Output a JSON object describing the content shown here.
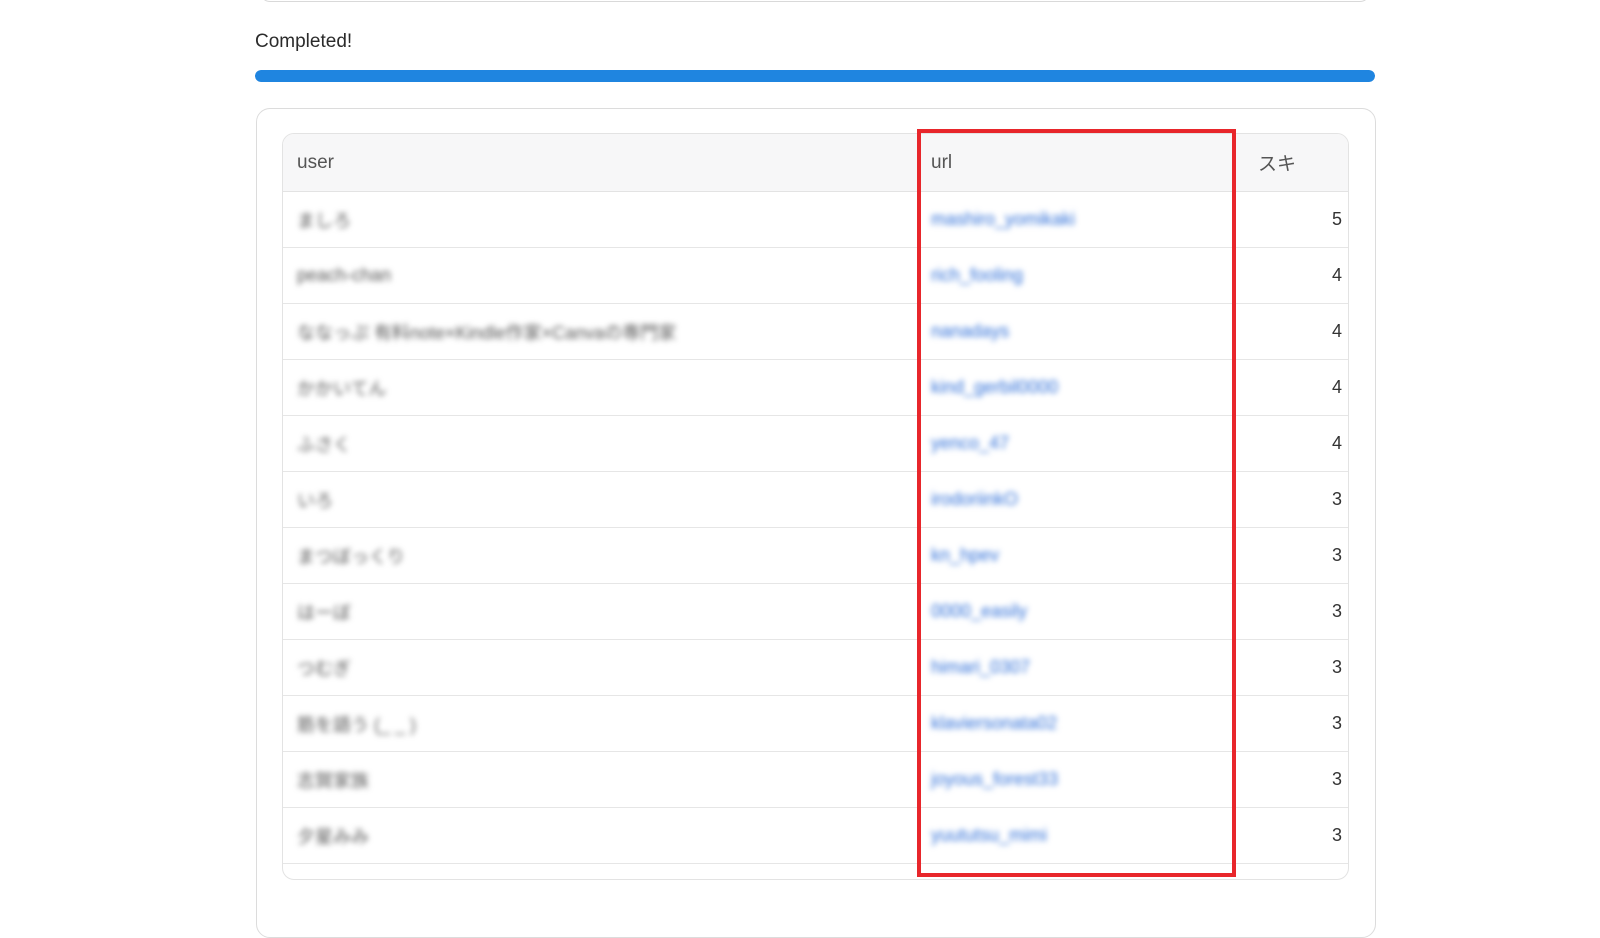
{
  "status": {
    "text": "Completed!",
    "progress": 1.0,
    "bar_color": "#1f85e0"
  },
  "table": {
    "columns": [
      "user",
      "url",
      "スキ"
    ],
    "rows": [
      {
        "user": "ましろ",
        "url": "mashiro_yomikaki",
        "ski": "5"
      },
      {
        "user": "peach-chan",
        "url": "rich_fooling",
        "ski": "4"
      },
      {
        "user": "ななっぷ 有料note×Kindle作家×Canvaの専門家",
        "url": "nanadays",
        "ski": "4"
      },
      {
        "user": "かかいてん",
        "url": "kind_gerbil0000",
        "ski": "4"
      },
      {
        "user": "ふさく",
        "url": "yenco_47",
        "ski": "4"
      },
      {
        "user": "いろ",
        "url": "irodoriinkO",
        "ski": "3"
      },
      {
        "user": "まつぼっくり",
        "url": "kn_hpev",
        "ski": "3"
      },
      {
        "user": "はーぼ",
        "url": "0000_easily",
        "ski": "3"
      },
      {
        "user": "つむぎ",
        "url": "himari_0307",
        "ski": "3"
      },
      {
        "user": "筋を語う (_ _ )",
        "url": "klaviersonata02",
        "ski": "3"
      },
      {
        "user": "志賀家族",
        "url": "joyous_forest33",
        "ski": "3"
      },
      {
        "user": "夕星みみ",
        "url": "yuututsu_mimi",
        "ski": "3"
      }
    ]
  },
  "highlight": {
    "target_column": "url",
    "color": "#e8262b"
  }
}
